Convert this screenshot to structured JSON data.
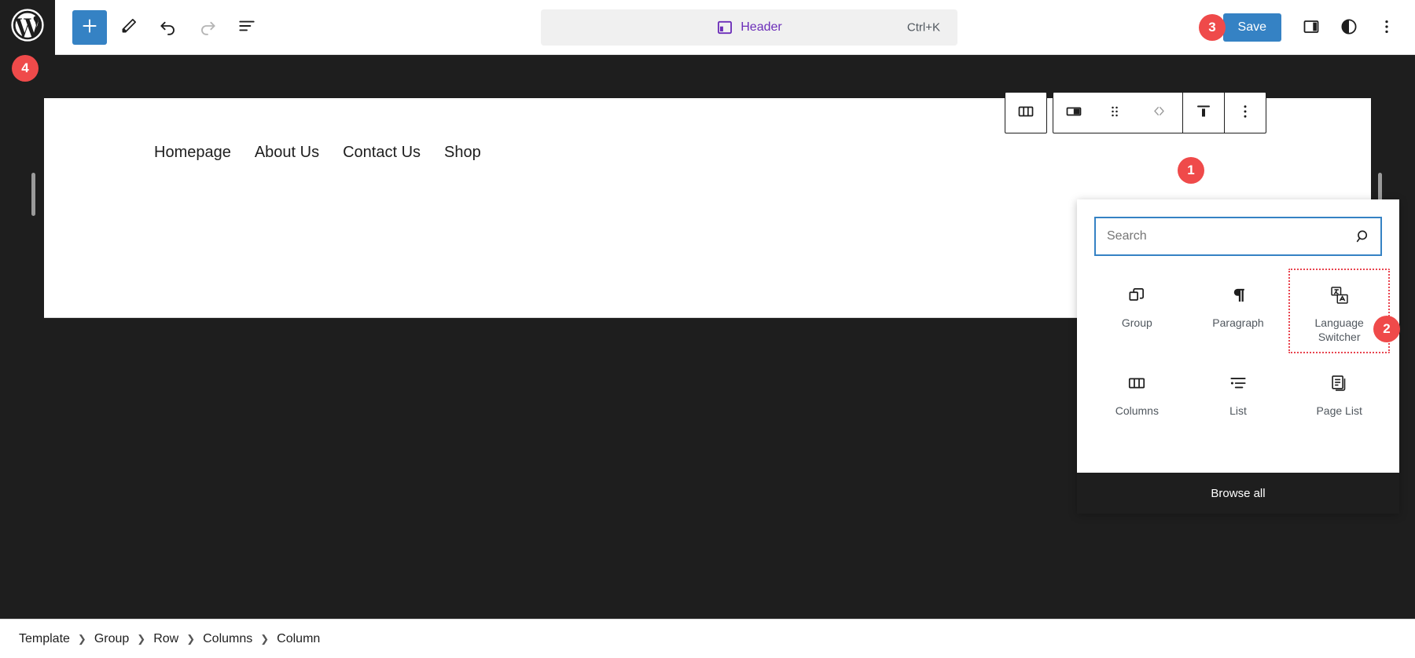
{
  "topbar": {
    "logo_icon": "wordpress-logo-icon",
    "tools": [
      {
        "name": "block-inserter-button",
        "icon": "plus-icon",
        "primary": true
      },
      {
        "name": "edit-tool-button",
        "icon": "pencil-icon",
        "primary": false
      },
      {
        "name": "undo-button",
        "icon": "undo-arrow-icon",
        "primary": false
      },
      {
        "name": "redo-button",
        "icon": "redo-arrow-icon",
        "primary": false
      },
      {
        "name": "document-overview-button",
        "icon": "list-view-icon",
        "primary": false
      }
    ],
    "command_center": {
      "icon": "header-template-icon",
      "label": "Header",
      "shortcut": "Ctrl+K"
    },
    "save_label": "Save",
    "right_icons": [
      {
        "name": "settings-sidebar-toggle",
        "icon": "sidebar-panel-icon"
      },
      {
        "name": "styles-toggle",
        "icon": "contrast-circle-icon"
      },
      {
        "name": "options-menu-button",
        "icon": "three-dots-vertical-icon"
      }
    ],
    "accent_color": "#3582c4",
    "command_label_color": "#6c2eb9"
  },
  "canvas": {
    "nav_items": [
      {
        "label": "Homepage"
      },
      {
        "label": "About Us"
      },
      {
        "label": "Contact Us"
      },
      {
        "label": "Shop"
      }
    ],
    "resize_handles": [
      "left-resize-handle",
      "right-resize-handle"
    ]
  },
  "block_toolbar": {
    "parent_button": {
      "name": "select-parent-columns-button",
      "icon": "columns-icon"
    },
    "items": [
      {
        "name": "change-block-type-button",
        "icon": "column-block-icon"
      },
      {
        "name": "drag-handle",
        "icon": "drag-dots-icon"
      },
      {
        "name": "move-arrows",
        "icon": "chevron-left-right-icon"
      },
      {
        "name": "vertical-align-button",
        "icon": "align-top-icon"
      },
      {
        "name": "block-options-button",
        "icon": "three-dots-vertical-icon"
      }
    ]
  },
  "inserter": {
    "plus_button": {
      "name": "add-block-button",
      "icon": "plus-icon"
    },
    "search": {
      "placeholder": "Search",
      "value": "",
      "icon": "search-magnifier-icon"
    },
    "blocks": [
      {
        "label": "Group",
        "icon": "group-blocks-icon",
        "highlight": false
      },
      {
        "label": "Paragraph",
        "icon": "paragraph-pilcrow-icon",
        "highlight": false
      },
      {
        "label": "Language Switcher",
        "icon": "language-translate-icon",
        "highlight": true
      },
      {
        "label": "Columns",
        "icon": "columns-icon",
        "highlight": false
      },
      {
        "label": "List",
        "icon": "bullet-list-icon",
        "highlight": false
      },
      {
        "label": "Page List",
        "icon": "page-list-icon",
        "highlight": false
      }
    ],
    "browse_all_label": "Browse all",
    "highlight_color": "#e8444f"
  },
  "breadcrumb": {
    "separator": "❯",
    "items": [
      {
        "label": "Template"
      },
      {
        "label": "Group"
      },
      {
        "label": "Row"
      },
      {
        "label": "Columns"
      },
      {
        "label": "Column"
      }
    ]
  },
  "badges": [
    {
      "label": "1"
    },
    {
      "label": "2"
    },
    {
      "label": "3"
    },
    {
      "label": "4"
    }
  ],
  "colors": {
    "badge": "#ef4a4a",
    "chrome_dark": "#1e1e1e",
    "accent_blue": "#3582c4",
    "purple": "#6c2eb9"
  }
}
